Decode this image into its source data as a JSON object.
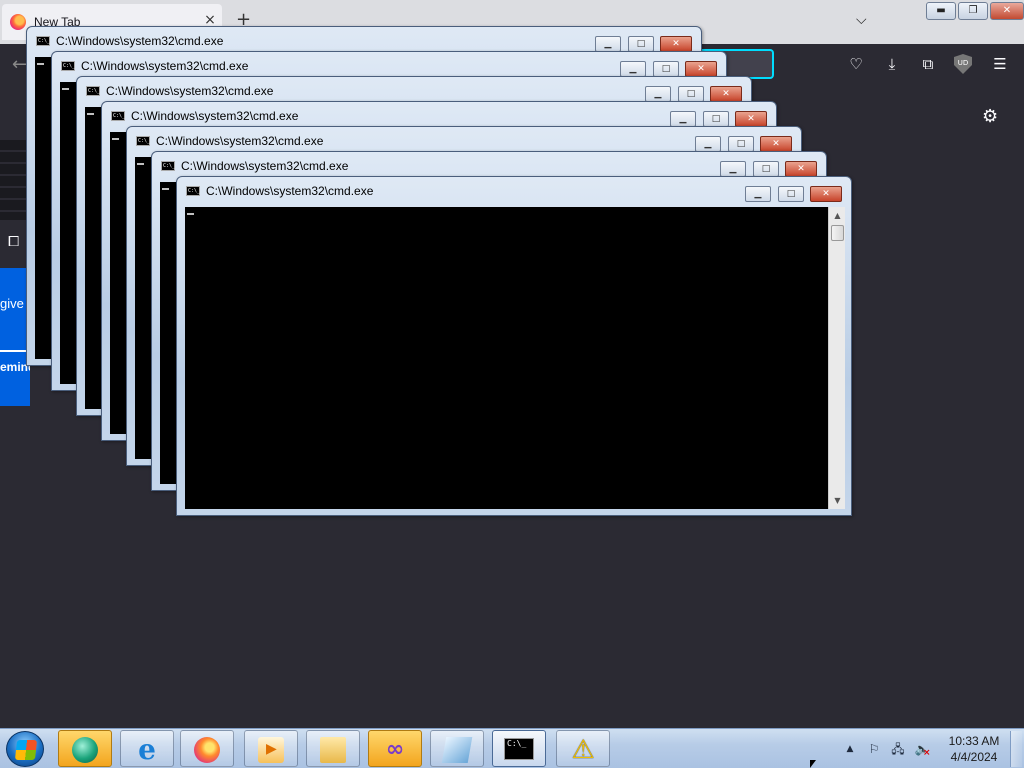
{
  "browser": {
    "tab_title": "New Tab",
    "tab_close": "×",
    "new_tab": "+",
    "back": "←",
    "list_all_tabs": "⌵",
    "toolbar_icons": {
      "pocket": "pocket-icon",
      "download": "download-icon",
      "extensions": "puzzle-icon",
      "ublock": "ublock-origin-icon",
      "menu": "hamburger-menu-icon"
    },
    "ublock_label": "UD",
    "settings_gear": "⚙",
    "banner_text": "give y",
    "banner_button": "emind m"
  },
  "os_window_controls": {
    "minimize": "▬",
    "restore": "❐",
    "close": "✕"
  },
  "cmd_windows": [
    {
      "title": "C:\\Windows\\system32\\cmd.exe"
    },
    {
      "title": "C:\\Windows\\system32\\cmd.exe"
    },
    {
      "title": "C:\\Windows\\system32\\cmd.exe"
    },
    {
      "title": "C:\\Windows\\system32\\cmd.exe"
    },
    {
      "title": "C:\\Windows\\system32\\cmd.exe"
    },
    {
      "title": "C:\\Windows\\system32\\cmd.exe"
    },
    {
      "title": "C:\\Windows\\system32\\cmd.exe"
    }
  ],
  "cmd_controls": {
    "minimize": "▁",
    "maximize": "□",
    "close": "✕"
  },
  "cmd_icon_label": "C:\\_",
  "taskbar": {
    "pinned": [
      {
        "name": "globe-app-icon"
      },
      {
        "name": "internet-explorer-icon",
        "glyph": "e"
      },
      {
        "name": "firefox-icon"
      },
      {
        "name": "media-player-icon"
      },
      {
        "name": "file-explorer-icon"
      },
      {
        "name": "visual-studio-icon",
        "glyph": "∞"
      },
      {
        "name": "app-icon"
      },
      {
        "name": "cmd-icon",
        "glyph": "C:\\_"
      },
      {
        "name": "warning-icon",
        "glyph": "⚠"
      }
    ],
    "tray": {
      "expand": "▲",
      "flag": "⚐",
      "network": "🖧",
      "volume": "🔈"
    },
    "clock": {
      "time": "10:33 AM",
      "date": "4/4/2024"
    }
  },
  "colors": {
    "firefox_bg": "#2b2a33",
    "cmd_bg": "#000000",
    "taskbar": "#b7cce7",
    "close_red": "#c7432a",
    "banner_blue": "#0061e0"
  }
}
